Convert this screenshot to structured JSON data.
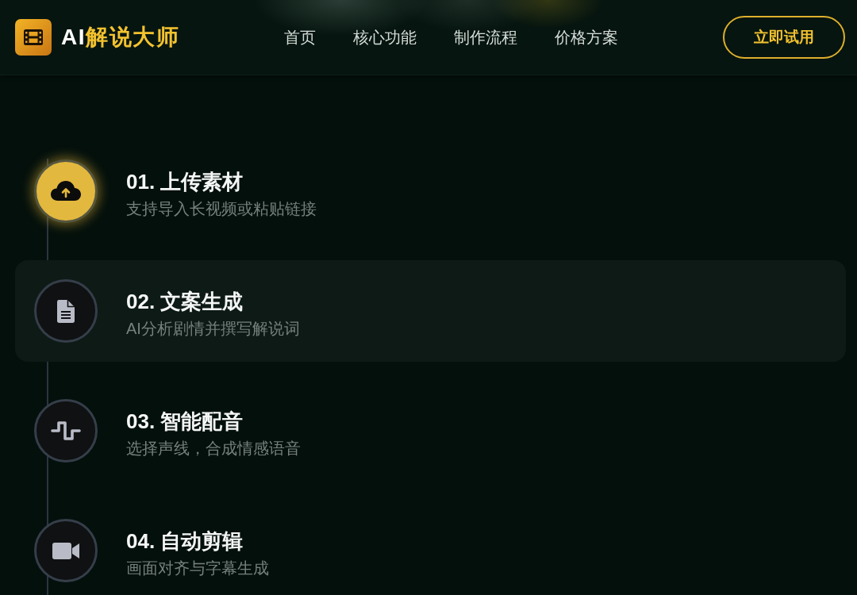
{
  "header": {
    "logo": {
      "prefix": "AI",
      "name": "解说大师"
    },
    "nav": [
      {
        "label": "首页"
      },
      {
        "label": "核心功能"
      },
      {
        "label": "制作流程"
      },
      {
        "label": "价格方案"
      }
    ],
    "cta": "立即试用"
  },
  "steps": [
    {
      "kind": "upload",
      "title": "01. 上传素材",
      "description": "支持导入长视频或粘贴链接",
      "active": true,
      "highlighted": false
    },
    {
      "kind": "document",
      "title": "02. 文案生成",
      "description": "AI分析剧情并撰写解说词",
      "active": false,
      "highlighted": true
    },
    {
      "kind": "audio",
      "title": "03. 智能配音",
      "description": "选择声线，合成情感语音",
      "active": false,
      "highlighted": false
    },
    {
      "kind": "video",
      "title": "04. 自动剪辑",
      "description": "画面对齐与字幕生成",
      "active": false,
      "highlighted": false
    }
  ]
}
